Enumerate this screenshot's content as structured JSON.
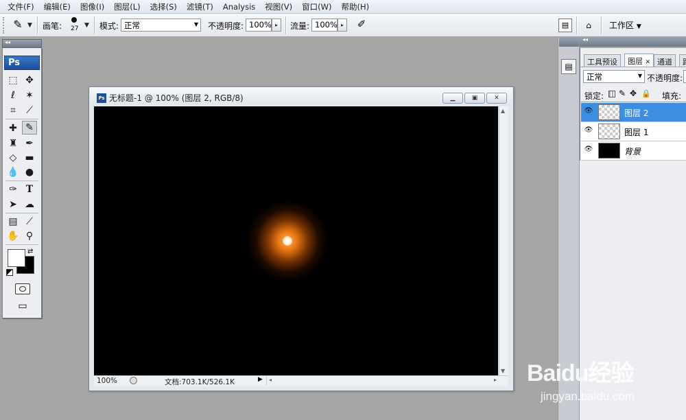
{
  "menu": [
    "文件(F)",
    "编辑(E)",
    "图像(I)",
    "图层(L)",
    "选择(S)",
    "滤镜(T)",
    "Analysis",
    "视图(V)",
    "窗口(W)",
    "帮助(H)"
  ],
  "options": {
    "brush_label": "画笔:",
    "brush_size": "27",
    "mode_label": "模式:",
    "mode_value": "正常",
    "opacity_label": "不透明度:",
    "opacity_value": "100%",
    "flow_label": "流量:",
    "flow_value": "100%",
    "workspace_label": "工作区"
  },
  "toolbox": {
    "logo": "Ps",
    "tools": [
      "rectangular-marquee",
      "move",
      "lasso",
      "magic-wand",
      "crop",
      "slice",
      "healing-brush",
      "brush",
      "clone-stamp",
      "history-brush",
      "eraser",
      "gradient",
      "blur",
      "dodge",
      "pen",
      "type",
      "path-selection",
      "custom-shape",
      "notes",
      "eyedropper",
      "hand",
      "zoom"
    ]
  },
  "document": {
    "title": "无标题-1 @ 100% (图层 2, RGB/8)",
    "zoom": "100%",
    "doc_info": "文档:703.1K/526.1K",
    "window_buttons": [
      "minimize",
      "maximize",
      "close"
    ]
  },
  "layers_panel": {
    "tabs": [
      "工具预设",
      "图层",
      "通道",
      "路"
    ],
    "active_tab": "图层",
    "blend_mode": "正常",
    "opacity_label": "不透明度:",
    "lock_label": "锁定:",
    "fill_label": "填充:",
    "layers": [
      {
        "name": "图层 2",
        "selected": true
      },
      {
        "name": "图层 1",
        "selected": false
      },
      {
        "name": "背景",
        "selected": false
      }
    ]
  },
  "watermark": {
    "logo": "Baidu经验",
    "url": "jingyan.baidu.com"
  },
  "colors": {
    "canvas": "#000000",
    "glow": "#f07d14",
    "selection": "#3d8ee0"
  }
}
